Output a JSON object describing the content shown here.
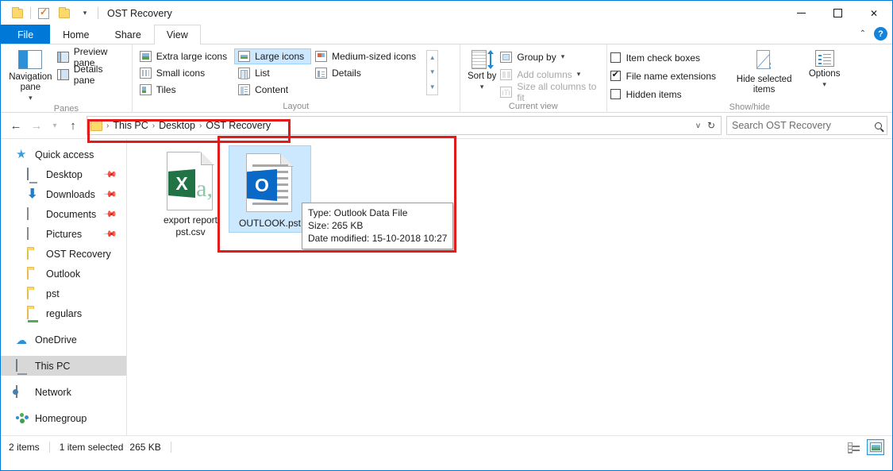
{
  "window": {
    "title": "OST Recovery",
    "quick_access_icons": [
      "folder-icon",
      "properties-checklist-icon",
      "new-folder-icon",
      "customize-dropdown-icon"
    ],
    "controls": {
      "minimize": "minimize-icon",
      "maximize": "maximize-icon",
      "close": "close-icon"
    }
  },
  "ribbon": {
    "tabs": [
      {
        "label": "File",
        "id": "file"
      },
      {
        "label": "Home",
        "id": "home"
      },
      {
        "label": "Share",
        "id": "share"
      },
      {
        "label": "View",
        "id": "view"
      }
    ],
    "active_tab": "View",
    "collapse_label": "^",
    "help_label": "?",
    "groups": [
      {
        "label": "Panes",
        "big_button": "Navigation pane",
        "items": [
          {
            "label": "Preview pane",
            "enabled": true
          },
          {
            "label": "Details pane",
            "enabled": true
          }
        ]
      },
      {
        "label": "Layout",
        "items": [
          {
            "label": "Extra large icons",
            "selected": false
          },
          {
            "label": "Small icons",
            "selected": false
          },
          {
            "label": "Tiles",
            "selected": false
          },
          {
            "label": "Large icons",
            "selected": true
          },
          {
            "label": "List",
            "selected": false
          },
          {
            "label": "Content",
            "selected": false
          },
          {
            "label": "Medium-sized icons",
            "selected": false
          },
          {
            "label": "Details",
            "selected": false
          }
        ]
      },
      {
        "label": "Current view",
        "big_button": "Sort by",
        "items": [
          {
            "label": "Group by",
            "enabled": true
          },
          {
            "label": "Add columns",
            "enabled": false
          },
          {
            "label": "Size all columns to fit",
            "enabled": false
          }
        ]
      },
      {
        "label": "Show/hide",
        "checkboxes": [
          {
            "label": "Item check boxes",
            "checked": false
          },
          {
            "label": "File name extensions",
            "checked": true
          },
          {
            "label": "Hidden items",
            "checked": false
          }
        ],
        "hide_selected": "Hide selected items",
        "options": "Options"
      }
    ]
  },
  "address": {
    "back": "back-arrow",
    "forward": "forward-arrow",
    "recent": "recent-dropdown",
    "up": "up-arrow",
    "breadcrumbs": [
      "This PC",
      "Desktop",
      "OST Recovery"
    ],
    "dropdown": "v",
    "refresh": "↻",
    "search_placeholder": "Search OST Recovery",
    "search_value": ""
  },
  "sidebar": {
    "items": [
      {
        "label": "Quick access",
        "icon": "star-icon",
        "indent": false,
        "pinned": false,
        "selected": false
      },
      {
        "label": "Desktop",
        "icon": "desktop-icon",
        "indent": true,
        "pinned": true,
        "selected": false
      },
      {
        "label": "Downloads",
        "icon": "downloads-icon",
        "indent": true,
        "pinned": true,
        "selected": false
      },
      {
        "label": "Documents",
        "icon": "documents-icon",
        "indent": true,
        "pinned": true,
        "selected": false
      },
      {
        "label": "Pictures",
        "icon": "pictures-icon",
        "indent": true,
        "pinned": true,
        "selected": false
      },
      {
        "label": "OST Recovery",
        "icon": "folder-icon",
        "indent": true,
        "pinned": false,
        "selected": false
      },
      {
        "label": "Outlook",
        "icon": "folder-icon",
        "indent": true,
        "pinned": false,
        "selected": false
      },
      {
        "label": "pst",
        "icon": "folder-icon",
        "indent": true,
        "pinned": false,
        "selected": false
      },
      {
        "label": "regulars",
        "icon": "shared-folder-icon",
        "indent": true,
        "pinned": false,
        "selected": false
      },
      {
        "label": "OneDrive",
        "icon": "onedrive-cloud-icon",
        "indent": false,
        "pinned": false,
        "selected": false
      },
      {
        "label": "This PC",
        "icon": "this-pc-icon",
        "indent": false,
        "pinned": false,
        "selected": true
      },
      {
        "label": "Network",
        "icon": "network-icon",
        "indent": false,
        "pinned": false,
        "selected": false
      },
      {
        "label": "Homegroup",
        "icon": "homegroup-icon",
        "indent": false,
        "pinned": false,
        "selected": false
      }
    ]
  },
  "files": [
    {
      "name": "export report pst.csv",
      "icon": "excel-csv-file-icon",
      "selected": false
    },
    {
      "name": "OUTLOOK.pst",
      "icon": "outlook-data-file-icon",
      "selected": true
    }
  ],
  "tooltip": {
    "type_line": "Type: Outlook Data File",
    "size_line": "Size: 265 KB",
    "date_line": "Date modified: 15-10-2018 10:27"
  },
  "statusbar": {
    "item_count": "2 items",
    "selection": "1 item selected",
    "selection_size": "265 KB",
    "view_details": "details-view-button",
    "view_large_icons": "large-icons-view-button"
  },
  "annotations": {
    "accent_color": "#e21b1b",
    "boxes": [
      "address-breadcrumb-highlight",
      "selected-file-highlight"
    ]
  }
}
